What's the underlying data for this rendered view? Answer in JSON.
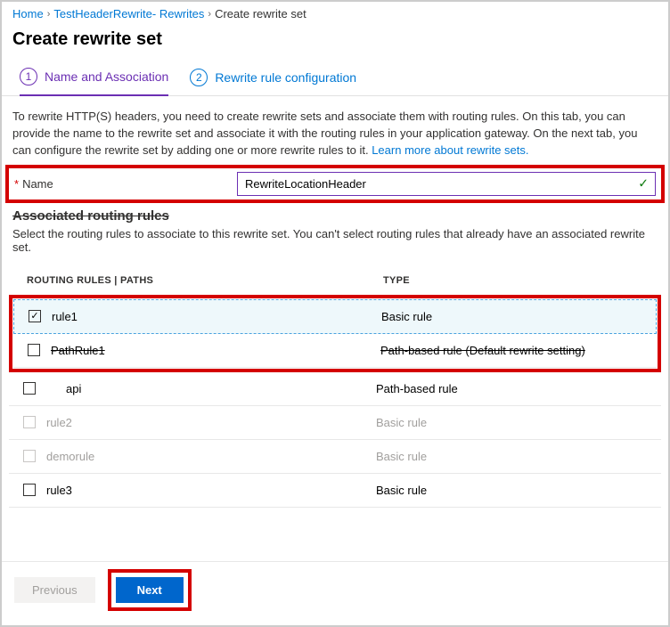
{
  "breadcrumb": {
    "home": "Home",
    "mid": "TestHeaderRewrite- Rewrites",
    "cur": "Create rewrite set"
  },
  "title": "Create rewrite set",
  "tabs": {
    "t1": "Name and Association",
    "n1": "1",
    "t2": "Rewrite rule configuration",
    "n2": "2"
  },
  "desc": {
    "text": "To rewrite HTTP(S) headers, you need to create rewrite sets and associate them with routing rules. On this tab, you can provide the name to the rewrite set and associate it with the routing rules in your application gateway. On the next tab, you can configure the rewrite set by adding one or more rewrite rules to it.  ",
    "link": "Learn more about rewrite sets."
  },
  "name": {
    "label": "Name",
    "value": "RewriteLocationHeader"
  },
  "section": {
    "title": "Associated routing rules",
    "desc": "Select the routing rules to associate to this rewrite set. You can't select routing rules that already have an associated rewrite set."
  },
  "headers": {
    "c1": "ROUTING RULES | PATHS",
    "c2": "TYPE"
  },
  "rows": [
    {
      "name": "rule1",
      "type": "Basic rule",
      "sel": true,
      "dis": false,
      "indent": false,
      "strike": false
    },
    {
      "name": "PathRule1",
      "type": "Path-based rule (Default rewrite setting)",
      "sel": false,
      "dis": false,
      "indent": false,
      "strike": true
    },
    {
      "name": "api",
      "type": "Path-based rule",
      "sel": false,
      "dis": false,
      "indent": true,
      "strike": false
    },
    {
      "name": "rule2",
      "type": "Basic rule",
      "sel": false,
      "dis": true,
      "indent": false,
      "strike": false
    },
    {
      "name": "demorule",
      "type": "Basic rule",
      "sel": false,
      "dis": true,
      "indent": false,
      "strike": false
    },
    {
      "name": "rule3",
      "type": "Basic rule",
      "sel": false,
      "dis": false,
      "indent": false,
      "strike": false
    }
  ],
  "buttons": {
    "prev": "Previous",
    "next": "Next"
  }
}
